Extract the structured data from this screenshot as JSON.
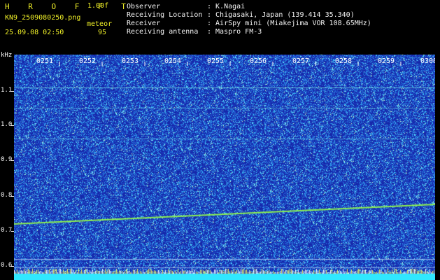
{
  "header": {
    "logo": "H R O F F T",
    "version": "1.00f",
    "filename": "KN9_2509080250.png",
    "meteor_label": "meteor",
    "datetime": "25.09.08 02:50",
    "meteor_count": "95",
    "observer_label": "Observer",
    "observer_value": ": K.Nagai",
    "location_label": "Receiving Location",
    "location_value": ": Chigasaki, Japan (139.414 35.340)",
    "receiver_label": "Receiver",
    "receiver_value": ": AirSpy mini (Miakejima VOR 108.65MHz)",
    "antenna_label": "Receiving antenna",
    "antenna_value": ": Maspro FM-3"
  },
  "yaxis": {
    "unit": "kHz",
    "ticks": [
      "1.1",
      "1.0",
      "0.9",
      "0.8",
      "0.7",
      "0.6"
    ]
  },
  "xaxis": {
    "ticks": [
      "0251",
      "0252",
      "0253",
      "0254",
      "0255",
      "0256",
      "0257",
      "0258",
      "0259",
      "0300"
    ]
  },
  "colors": {
    "background": "#1a2aa8",
    "header_yellow": "#f0f028",
    "header_white": "#f4f4f4",
    "signal": "#8cf050",
    "noise_bright": "#3ce0ff",
    "bottom_bar": "#30e8ff"
  }
}
